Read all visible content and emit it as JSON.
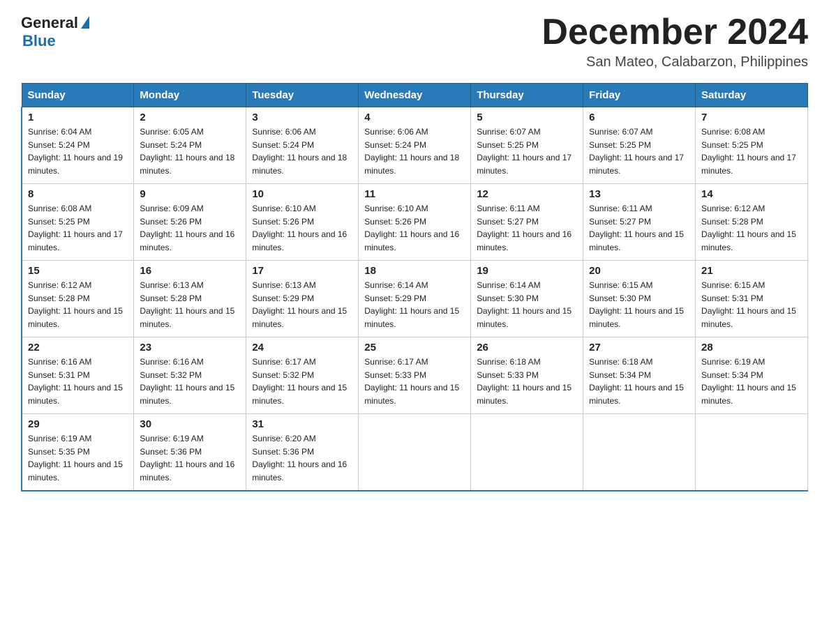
{
  "logo": {
    "general": "General",
    "blue": "Blue"
  },
  "header": {
    "month": "December 2024",
    "location": "San Mateo, Calabarzon, Philippines"
  },
  "days_of_week": [
    "Sunday",
    "Monday",
    "Tuesday",
    "Wednesday",
    "Thursday",
    "Friday",
    "Saturday"
  ],
  "weeks": [
    [
      {
        "day": "1",
        "sunrise": "6:04 AM",
        "sunset": "5:24 PM",
        "daylight": "11 hours and 19 minutes."
      },
      {
        "day": "2",
        "sunrise": "6:05 AM",
        "sunset": "5:24 PM",
        "daylight": "11 hours and 18 minutes."
      },
      {
        "day": "3",
        "sunrise": "6:06 AM",
        "sunset": "5:24 PM",
        "daylight": "11 hours and 18 minutes."
      },
      {
        "day": "4",
        "sunrise": "6:06 AM",
        "sunset": "5:24 PM",
        "daylight": "11 hours and 18 minutes."
      },
      {
        "day": "5",
        "sunrise": "6:07 AM",
        "sunset": "5:25 PM",
        "daylight": "11 hours and 17 minutes."
      },
      {
        "day": "6",
        "sunrise": "6:07 AM",
        "sunset": "5:25 PM",
        "daylight": "11 hours and 17 minutes."
      },
      {
        "day": "7",
        "sunrise": "6:08 AM",
        "sunset": "5:25 PM",
        "daylight": "11 hours and 17 minutes."
      }
    ],
    [
      {
        "day": "8",
        "sunrise": "6:08 AM",
        "sunset": "5:25 PM",
        "daylight": "11 hours and 17 minutes."
      },
      {
        "day": "9",
        "sunrise": "6:09 AM",
        "sunset": "5:26 PM",
        "daylight": "11 hours and 16 minutes."
      },
      {
        "day": "10",
        "sunrise": "6:10 AM",
        "sunset": "5:26 PM",
        "daylight": "11 hours and 16 minutes."
      },
      {
        "day": "11",
        "sunrise": "6:10 AM",
        "sunset": "5:26 PM",
        "daylight": "11 hours and 16 minutes."
      },
      {
        "day": "12",
        "sunrise": "6:11 AM",
        "sunset": "5:27 PM",
        "daylight": "11 hours and 16 minutes."
      },
      {
        "day": "13",
        "sunrise": "6:11 AM",
        "sunset": "5:27 PM",
        "daylight": "11 hours and 15 minutes."
      },
      {
        "day": "14",
        "sunrise": "6:12 AM",
        "sunset": "5:28 PM",
        "daylight": "11 hours and 15 minutes."
      }
    ],
    [
      {
        "day": "15",
        "sunrise": "6:12 AM",
        "sunset": "5:28 PM",
        "daylight": "11 hours and 15 minutes."
      },
      {
        "day": "16",
        "sunrise": "6:13 AM",
        "sunset": "5:28 PM",
        "daylight": "11 hours and 15 minutes."
      },
      {
        "day": "17",
        "sunrise": "6:13 AM",
        "sunset": "5:29 PM",
        "daylight": "11 hours and 15 minutes."
      },
      {
        "day": "18",
        "sunrise": "6:14 AM",
        "sunset": "5:29 PM",
        "daylight": "11 hours and 15 minutes."
      },
      {
        "day": "19",
        "sunrise": "6:14 AM",
        "sunset": "5:30 PM",
        "daylight": "11 hours and 15 minutes."
      },
      {
        "day": "20",
        "sunrise": "6:15 AM",
        "sunset": "5:30 PM",
        "daylight": "11 hours and 15 minutes."
      },
      {
        "day": "21",
        "sunrise": "6:15 AM",
        "sunset": "5:31 PM",
        "daylight": "11 hours and 15 minutes."
      }
    ],
    [
      {
        "day": "22",
        "sunrise": "6:16 AM",
        "sunset": "5:31 PM",
        "daylight": "11 hours and 15 minutes."
      },
      {
        "day": "23",
        "sunrise": "6:16 AM",
        "sunset": "5:32 PM",
        "daylight": "11 hours and 15 minutes."
      },
      {
        "day": "24",
        "sunrise": "6:17 AM",
        "sunset": "5:32 PM",
        "daylight": "11 hours and 15 minutes."
      },
      {
        "day": "25",
        "sunrise": "6:17 AM",
        "sunset": "5:33 PM",
        "daylight": "11 hours and 15 minutes."
      },
      {
        "day": "26",
        "sunrise": "6:18 AM",
        "sunset": "5:33 PM",
        "daylight": "11 hours and 15 minutes."
      },
      {
        "day": "27",
        "sunrise": "6:18 AM",
        "sunset": "5:34 PM",
        "daylight": "11 hours and 15 minutes."
      },
      {
        "day": "28",
        "sunrise": "6:19 AM",
        "sunset": "5:34 PM",
        "daylight": "11 hours and 15 minutes."
      }
    ],
    [
      {
        "day": "29",
        "sunrise": "6:19 AM",
        "sunset": "5:35 PM",
        "daylight": "11 hours and 15 minutes."
      },
      {
        "day": "30",
        "sunrise": "6:19 AM",
        "sunset": "5:36 PM",
        "daylight": "11 hours and 16 minutes."
      },
      {
        "day": "31",
        "sunrise": "6:20 AM",
        "sunset": "5:36 PM",
        "daylight": "11 hours and 16 minutes."
      },
      null,
      null,
      null,
      null
    ]
  ]
}
